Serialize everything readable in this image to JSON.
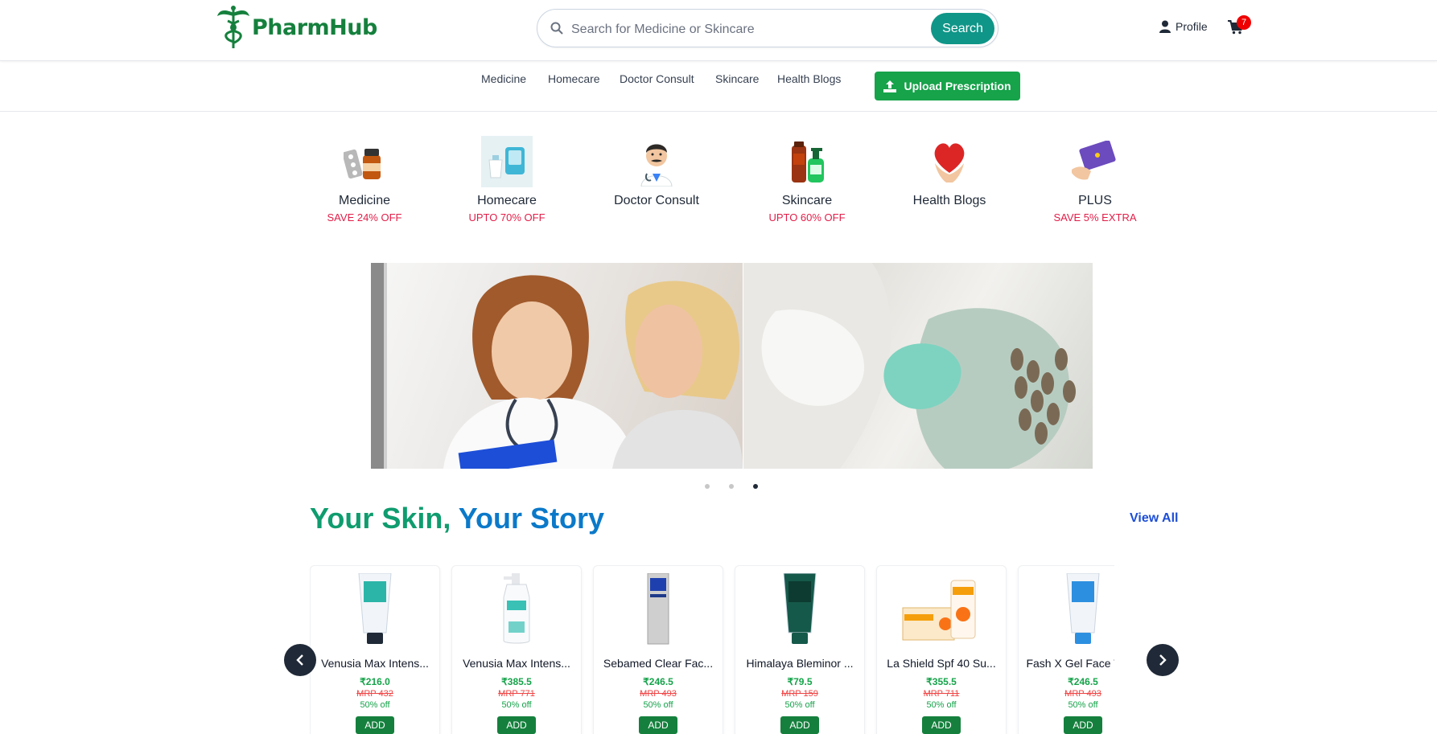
{
  "header": {
    "brand": "PharmHub",
    "search_placeholder": "Search for Medicine or Skincare",
    "search_button": "Search",
    "profile_label": "Profile",
    "cart_count": "7"
  },
  "nav": {
    "items": [
      "Medicine",
      "Homecare",
      "Doctor Consult",
      "Skincare",
      "Health Blogs"
    ],
    "upload_label": "Upload Prescription"
  },
  "categories": [
    {
      "label": "Medicine",
      "offer": "SAVE 24% OFF",
      "icon": "medicine-icon"
    },
    {
      "label": "Homecare",
      "offer": "UPTO 70% OFF",
      "icon": "homecare-icon"
    },
    {
      "label": "Doctor Consult",
      "offer": "",
      "icon": "doctor-icon"
    },
    {
      "label": "Skincare",
      "offer": "UPTO 60% OFF",
      "icon": "skincare-icon"
    },
    {
      "label": "Health Blogs",
      "offer": "",
      "icon": "heart-icon"
    },
    {
      "label": "PLUS",
      "offer": "SAVE 5% EXTRA",
      "icon": "plus-card-icon"
    }
  ],
  "banner": {
    "active_slide": 3,
    "slide_count": 3
  },
  "section": {
    "title_part1": "Your Skin,",
    "title_part2": "Your Story",
    "view_all": "View All"
  },
  "products": [
    {
      "name": "Venusia Max Intens...",
      "price": "₹216.0",
      "mrp": "MRP 432",
      "off": "50% off",
      "add": "ADD",
      "tube_color": "#2bb5a8"
    },
    {
      "name": "Venusia Max Intens...",
      "price": "₹385.5",
      "mrp": "MRP 771",
      "off": "50% off",
      "add": "ADD",
      "tube_color": "#39c1b5"
    },
    {
      "name": "Sebamed Clear Fac...",
      "price": "₹246.5",
      "mrp": "MRP 493",
      "off": "50% off",
      "add": "ADD",
      "tube_color": "#b9b9b9"
    },
    {
      "name": "Himalaya Bleminor ...",
      "price": "₹79.5",
      "mrp": "MRP 159",
      "off": "50% off",
      "add": "ADD",
      "tube_color": "#15594a"
    },
    {
      "name": "La Shield Spf 40 Su...",
      "price": "₹355.5",
      "mrp": "MRP 711",
      "off": "50% off",
      "add": "ADD",
      "tube_color": "#f59e0b"
    },
    {
      "name": "Fash X Gel Face Wa...",
      "price": "₹246.5",
      "mrp": "MRP 493",
      "off": "50% off",
      "add": "ADD",
      "tube_color": "#2d8fe0"
    }
  ],
  "colors": {
    "brand_green": "#15803d",
    "accent_teal": "#0f9688",
    "offer_red": "#e11d48",
    "title_green": "#0f9c6e",
    "title_blue": "#0b79c9"
  }
}
